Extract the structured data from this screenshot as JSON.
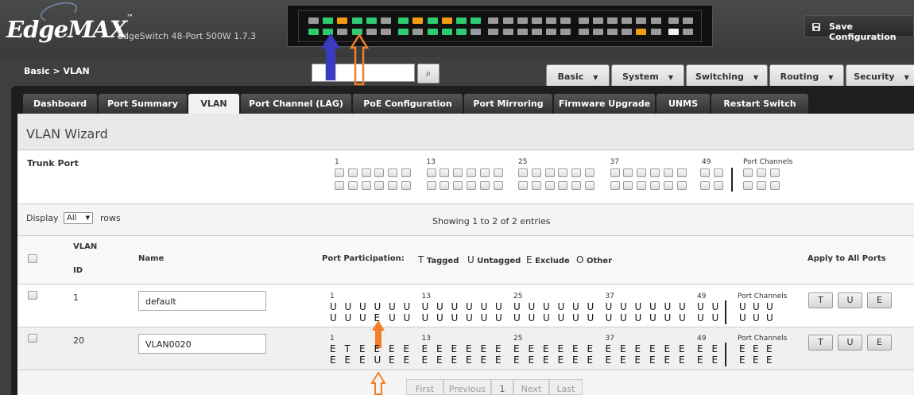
{
  "header": {
    "brand": "EdgeMAX",
    "trademark": "™",
    "model": "EdgeSwitch 48-Port 500W 1.7.3",
    "save_label": "Save Configuration"
  },
  "breadcrumb": "Basic > VLAN",
  "nav_menu": [
    {
      "label": "Basic"
    },
    {
      "label": "System"
    },
    {
      "label": "Switching"
    },
    {
      "label": "Routing"
    },
    {
      "label": "Security"
    }
  ],
  "tabs": [
    {
      "label": "Dashboard"
    },
    {
      "label": "Port Summary"
    },
    {
      "label": "VLAN",
      "active": true
    },
    {
      "label": "Port Channel (LAG)"
    },
    {
      "label": "PoE Configuration"
    },
    {
      "label": "Port Mirroring"
    },
    {
      "label": "Firmware Upgrade"
    },
    {
      "label": "UNMS"
    },
    {
      "label": "Restart Switch"
    }
  ],
  "wizard": {
    "title": "VLAN Wizard",
    "trunk_label": "Trunk Port",
    "group_numbers": [
      "1",
      "13",
      "25",
      "37",
      "49"
    ],
    "port_channels_label": "Port Channels"
  },
  "display": {
    "label": "Display",
    "value": "All",
    "suffix": "rows",
    "entries": "Showing 1 to 2 of 2 entries"
  },
  "table": {
    "headers": {
      "vlan_id_1": "VLAN",
      "vlan_id_2": "ID",
      "name": "Name",
      "participation": "Port Participation:",
      "apply": "Apply to All Ports"
    },
    "legend": [
      {
        "code": "T",
        "text": "Tagged"
      },
      {
        "code": "U",
        "text": "Untagged"
      },
      {
        "code": "E",
        "text": "Exclude"
      },
      {
        "code": "O",
        "text": "Other"
      }
    ],
    "rows": [
      {
        "id": "1",
        "name": "default",
        "top": "UUUUUUUUUUUUUUUUUUUUUUUUUUUUUUUUUUUUUUUUUUUUUUUUUUUU",
        "bottom": "UUUEUUUUUUUUUUUUUUUUUUUUUUUUUUUUUUUUUUUUUUUUUUUUUUUU",
        "pc_top": "UUU",
        "pc_bottom": "UUU",
        "group_numbers": [
          "1",
          "13",
          "25",
          "37",
          "49"
        ],
        "pc_label": "Port Channels",
        "buttons": [
          "T",
          "U",
          "E"
        ]
      },
      {
        "id": "20",
        "name": "VLAN0020",
        "top": "ETEEEEEEEEEEEEEEEEEEEEEEEEEEEEEEEEEEEEEEEEEEEEEEEEEE",
        "bottom": "EEEUEEEEEEEEEEEEEEEEEEEEEEEEEEEEEEEEEEEEEEEEEEEEEEEE",
        "pc_top": "EEE",
        "pc_bottom": "EEE",
        "group_numbers": [
          "1",
          "13",
          "25",
          "37",
          "49"
        ],
        "pc_label": "Port Channels",
        "buttons": [
          "T",
          "U",
          "E"
        ]
      }
    ]
  },
  "pagination": [
    "First",
    "Previous",
    "1",
    "Next",
    "Last"
  ],
  "port_panel": {
    "colors": {
      "green": "#2ecc71",
      "orange": "#f39c12",
      "gray": "#9a9a9a",
      "white": "#f0f0f0"
    },
    "top": [
      "gray",
      "green",
      "orange",
      "green",
      "green",
      "gray",
      "green",
      "orange",
      "green",
      "orange",
      "green",
      "green",
      "gray",
      "gray",
      "gray",
      "gray",
      "gray",
      "gray",
      "gray",
      "gray",
      "gray",
      "gray",
      "gray",
      "gray",
      "gray",
      "gray"
    ],
    "bottom": [
      "green",
      "green",
      "gray",
      "green",
      "gray",
      "gray",
      "green",
      "gray",
      "green",
      "green",
      "green",
      "gray",
      "gray",
      "gray",
      "gray",
      "gray",
      "gray",
      "gray",
      "gray",
      "gray",
      "gray",
      "gray",
      "orange",
      "gray",
      "white",
      "gray"
    ]
  },
  "annotation_colors": {
    "blue": "#3b3bbd",
    "orange": "#f57e2a"
  }
}
